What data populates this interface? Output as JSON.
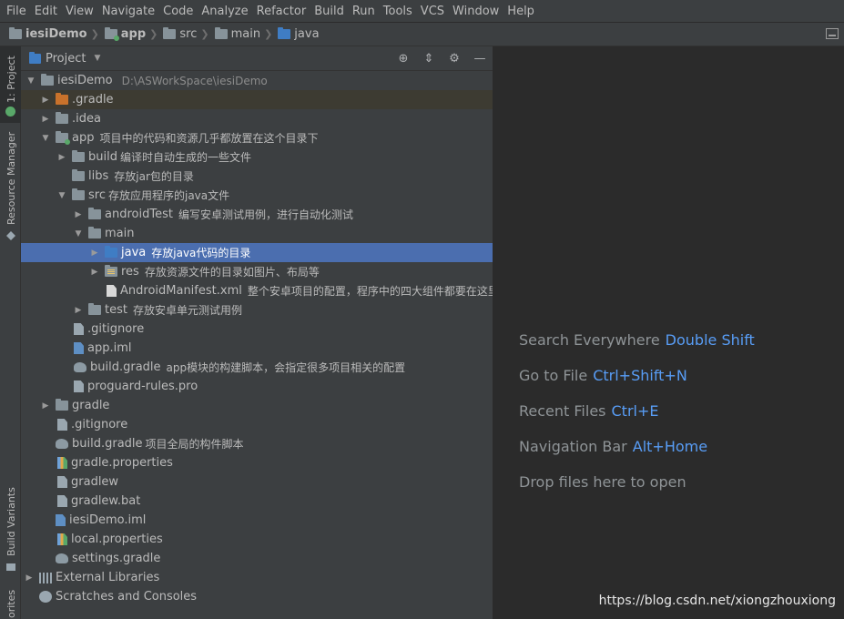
{
  "menu": [
    "File",
    "Edit",
    "View",
    "Navigate",
    "Code",
    "Analyze",
    "Refactor",
    "Build",
    "Run",
    "Tools",
    "VCS",
    "Window",
    "Help"
  ],
  "breadcrumb": [
    "iesiDemo",
    "app",
    "src",
    "main",
    "java"
  ],
  "side_tabs": {
    "project": "1: Project",
    "resource_manager": "Resource Manager",
    "build_variants": "Build Variants",
    "favorites": "orites"
  },
  "panel": {
    "title": "Project"
  },
  "tree": [
    {
      "name": "iesiDemo",
      "path": "D:\\ASWorkSpace\\iesiDemo",
      "note": ""
    },
    {
      "name": ".gradle",
      "note": ""
    },
    {
      "name": ".idea",
      "note": ""
    },
    {
      "name": "app",
      "note": "项目中的代码和资源几乎都放置在这个目录下"
    },
    {
      "name": "build",
      "note": "编译时自动生成的一些文件"
    },
    {
      "name": "libs",
      "note": "存放jar包的目录"
    },
    {
      "name": "src",
      "note": "存放应用程序的java文件"
    },
    {
      "name": "androidTest",
      "note": "编写安卓测试用例，进行自动化测试"
    },
    {
      "name": "main",
      "note": ""
    },
    {
      "name": "java",
      "note": "存放java代码的目录"
    },
    {
      "name": "res",
      "note": "存放资源文件的目录如图片、布局等"
    },
    {
      "name": "AndroidManifest.xml",
      "note": "整个安卓项目的配置，程序中的四大组件都要在这里配置，以及一些权限管理等"
    },
    {
      "name": "test",
      "note": "存放安卓单元测试用例"
    },
    {
      "name": ".gitignore",
      "note": ""
    },
    {
      "name": "app.iml",
      "note": ""
    },
    {
      "name": "build.gradle",
      "note": "app模块的构建脚本，会指定很多项目相关的配置"
    },
    {
      "name": "proguard-rules.pro",
      "note": ""
    },
    {
      "name": "gradle",
      "note": ""
    },
    {
      "name": ".gitignore",
      "note": ""
    },
    {
      "name": "build.gradle",
      "note": "项目全局的构件脚本"
    },
    {
      "name": "gradle.properties",
      "note": ""
    },
    {
      "name": "gradlew",
      "note": ""
    },
    {
      "name": "gradlew.bat",
      "note": ""
    },
    {
      "name": "iesiDemo.iml",
      "note": ""
    },
    {
      "name": "local.properties",
      "note": ""
    },
    {
      "name": "settings.gradle",
      "note": ""
    },
    {
      "name": "External Libraries",
      "note": ""
    },
    {
      "name": "Scratches and Consoles",
      "note": ""
    }
  ],
  "editor_hints": [
    {
      "label": "Search Everywhere",
      "key": "Double Shift"
    },
    {
      "label": "Go to File",
      "key": "Ctrl+Shift+N"
    },
    {
      "label": "Recent Files",
      "key": "Ctrl+E"
    },
    {
      "label": "Navigation Bar",
      "key": "Alt+Home"
    },
    {
      "label": "Drop files here to open",
      "key": ""
    }
  ],
  "watermark": "https://blog.csdn.net/xiongzhouxiong",
  "colors": {
    "selection": "#4b6eaf",
    "key_hint": "#589df6",
    "panel_bg": "#3c3f41",
    "editor_bg": "#2b2b2b"
  }
}
